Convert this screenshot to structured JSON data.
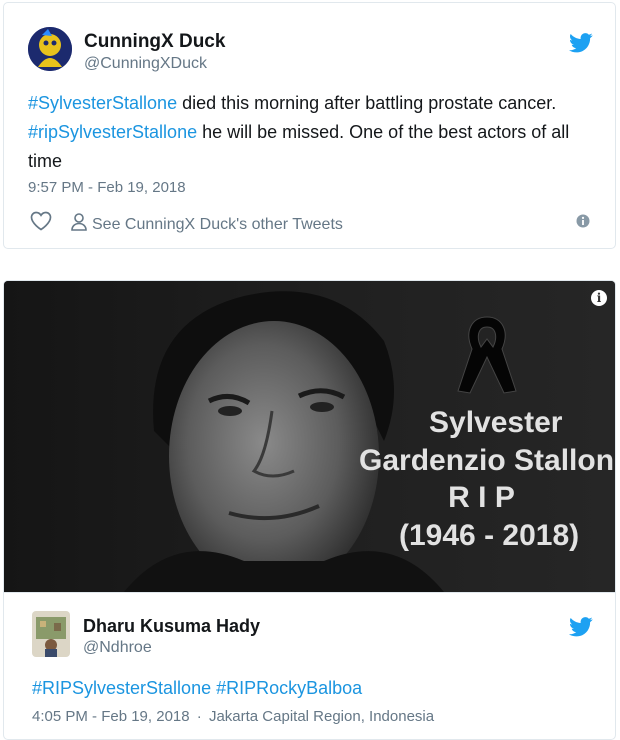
{
  "tweet1": {
    "author_name": "CunningX Duck",
    "author_handle": "@CunningXDuck",
    "text_parts": {
      "hashtag1": "#SylvesterStallone",
      "t1": " died this morning after battling prostate cancer. ",
      "hashtag2": "#ripSylvesterStallone",
      "t2": " he will be missed. One of the best actors of all time"
    },
    "timestamp": "9:57 PM - Feb 19, 2018",
    "see_other": "See CunningX Duck's other Tweets"
  },
  "media": {
    "line1": "Sylvester",
    "line2": "Gardenzio Stallone",
    "line3": "R I P",
    "line4": "(1946 - 2018)",
    "info_glyph": "i"
  },
  "tweet2": {
    "author_name": "Dharu Kusuma Hady",
    "author_handle": "@Ndhroe",
    "hashtag1": "#RIPSylvesterStallone",
    "hashtag2": "#RIPRockyBalboa",
    "timestamp": "4:05 PM - Feb 19, 2018",
    "separator": "·",
    "location": "Jakarta Capital Region, Indonesia"
  },
  "colors": {
    "link": "#1b95e0",
    "secondary": "#657786",
    "border": "#e1e8ed",
    "twitter_blue": "#1da1f2"
  },
  "icons": {
    "bird": "twitter-bird-icon",
    "heart": "heart-icon",
    "person": "person-icon",
    "info": "info-icon"
  }
}
